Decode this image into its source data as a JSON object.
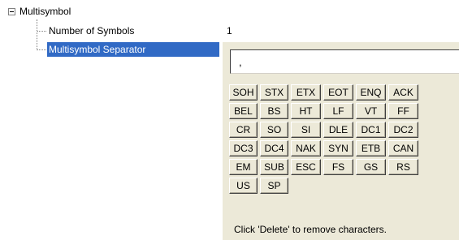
{
  "tree": {
    "root_label": "Multisymbol",
    "properties": [
      {
        "name": "Number of Symbols",
        "value": "1"
      },
      {
        "name": "Multisymbol Separator",
        "value": ","
      }
    ]
  },
  "editor": {
    "current_value": ",",
    "hint": "Click 'Delete' to remove characters.",
    "keys": [
      [
        "SOH",
        "STX",
        "ETX",
        "EOT",
        "ENQ",
        "ACK"
      ],
      [
        "BEL",
        "BS",
        "HT",
        "LF",
        "VT",
        "FF"
      ],
      [
        "CR",
        "SO",
        "SI",
        "DLE",
        "DC1",
        "DC2"
      ],
      [
        "DC3",
        "DC4",
        "NAK",
        "SYN",
        "ETB",
        "CAN"
      ],
      [
        "EM",
        "SUB",
        "ESC",
        "FS",
        "GS",
        "RS"
      ],
      [
        "US",
        "SP"
      ]
    ]
  }
}
